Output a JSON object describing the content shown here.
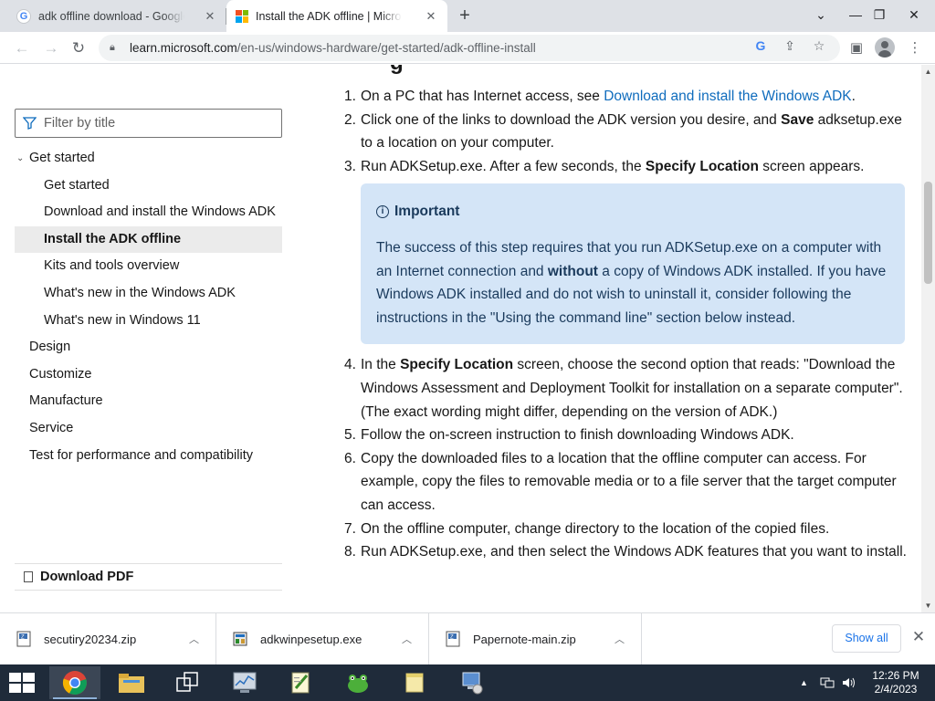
{
  "browser": {
    "tabs": [
      {
        "title": "adk offline download - Google Search",
        "favicon": "google-g-icon"
      },
      {
        "title": "Install the ADK offline | Microsoft Learn",
        "favicon": "microsoft-logo-icon"
      }
    ],
    "new_tab": "+",
    "url": {
      "host": "learn.microsoft.com",
      "path": "/en-us/windows-hardware/get-started/adk-offline-install"
    }
  },
  "sidebar": {
    "filter_placeholder": "Filter by title",
    "toc": [
      {
        "label": "Get started"
      },
      {
        "label": "Get started"
      },
      {
        "label": "Download and install the Windows ADK"
      },
      {
        "label": "Install the ADK offline"
      },
      {
        "label": "Kits and tools overview"
      },
      {
        "label": "What's new in the Windows ADK"
      },
      {
        "label": "What's new in Windows 11"
      },
      {
        "label": "Design"
      },
      {
        "label": "Customize"
      },
      {
        "label": "Manufacture"
      },
      {
        "label": "Service"
      },
      {
        "label": "Test for performance and compatibility"
      }
    ],
    "download_pdf": "Download PDF"
  },
  "content": {
    "steps": {
      "s1": {
        "num": "1.",
        "text": "On a PC that has Internet access, see ",
        "link": "Download and install the Windows ADK",
        "end": "."
      },
      "s2": {
        "num": "2.",
        "a": "Click one of the links to download the ADK version you desire, and ",
        "bold": "Save",
        "b": " adksetup.exe to a location on your computer."
      },
      "s3": {
        "num": "3.",
        "a": "Run ADKSetup.exe. After a few seconds, the ",
        "bold": "Specify Location",
        "b": " screen appears."
      },
      "s4": {
        "num": "4.",
        "a": "In the ",
        "bold": "Specify Location",
        "b": " screen, choose the second option that reads: \"Download the Windows Assessment and Deployment Toolkit for installation on a separate computer\". (The exact wording might differ, depending on the version of ADK.)"
      },
      "s5": {
        "num": "5.",
        "text": "Follow the on-screen instruction to finish downloading Windows ADK."
      },
      "s6": {
        "num": "6.",
        "text": "Copy the downloaded files to a location that the offline computer can access. For example, copy the files to removable media or to a file server that the target computer can access."
      },
      "s7": {
        "num": "7.",
        "text": "On the offline computer, change directory to the location of the copied files."
      },
      "s8": {
        "num": "8.",
        "text": "Run ADKSetup.exe, and then select the Windows ADK features that you want to install."
      }
    },
    "alert": {
      "title": "Important",
      "a": "The success of this step requires that you run ADKSetup.exe on a computer with an Internet connection and ",
      "bold": "without",
      "b": " a copy of Windows ADK installed. If you have Windows ADK installed and do not wish to uninstall it, consider following the instructions in the \"Using the command line\" section below instead."
    }
  },
  "downloads": {
    "items": [
      {
        "name": "secutiry20234.zip"
      },
      {
        "name": "adkwinpesetup.exe"
      },
      {
        "name": "Papernote-main.zip"
      }
    ],
    "show_all": "Show all"
  },
  "taskbar": {
    "time": "12:26 PM",
    "date": "2/4/2023"
  },
  "colors": {
    "link": "#0f6cbd",
    "alert_bg": "#d4e5f7",
    "taskbar": "#1f2b3a"
  }
}
